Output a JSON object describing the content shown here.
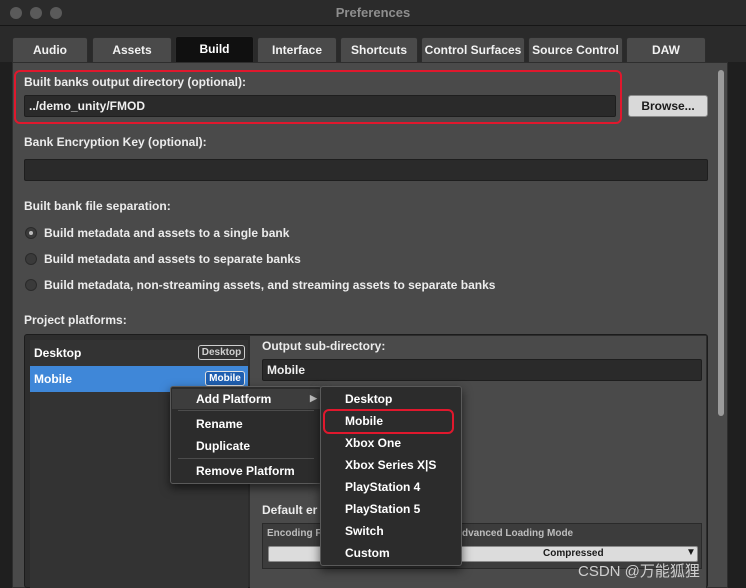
{
  "window": {
    "title": "Preferences"
  },
  "tabs": [
    {
      "label": "Audio"
    },
    {
      "label": "Assets"
    },
    {
      "label": "Build"
    },
    {
      "label": "Interface"
    },
    {
      "label": "Shortcuts"
    },
    {
      "label": "Control Surfaces"
    },
    {
      "label": "Source Control"
    },
    {
      "label": "DAW"
    }
  ],
  "active_tab": "Build",
  "build": {
    "output_dir_label": "Built banks output directory (optional):",
    "output_dir_value": "../demo_unity/FMOD",
    "browse_label": "Browse...",
    "encryption_label": "Bank Encryption Key (optional):",
    "encryption_value": "",
    "separation_label": "Built bank file separation:",
    "separation_options": [
      {
        "label": "Build metadata and assets to a single bank",
        "selected": true
      },
      {
        "label": "Build metadata and assets to separate banks",
        "selected": false
      },
      {
        "label": "Build metadata, non-streaming assets, and streaming assets to separate banks",
        "selected": false
      }
    ],
    "platforms_label": "Project platforms:",
    "platforms": [
      {
        "name": "Desktop",
        "badge": "Desktop",
        "selected": false
      },
      {
        "name": "Mobile",
        "badge": "Mobile",
        "selected": true
      }
    ],
    "output_subdir_label": "Output sub-directory:",
    "output_subdir_value": "Mobile",
    "default_encoding_label": "Default er",
    "encoding_col_label": "Encoding F",
    "loading_mode_col_label": "dvanced Loading Mode",
    "compressed_value": "Compressed"
  },
  "context_menu": {
    "items": [
      "Add Platform",
      "Rename",
      "Duplicate",
      "Remove Platform"
    ]
  },
  "platform_submenu": {
    "items": [
      "Desktop",
      "Mobile",
      "Xbox One",
      "Xbox Series X|S",
      "PlayStation 4",
      "PlayStation 5",
      "Switch",
      "Custom"
    ],
    "highlighted": "Mobile"
  },
  "watermark": "CSDN @万能狐狸",
  "colors": {
    "highlight_red": "#e0182d",
    "selection_blue": "#3f87d8"
  }
}
